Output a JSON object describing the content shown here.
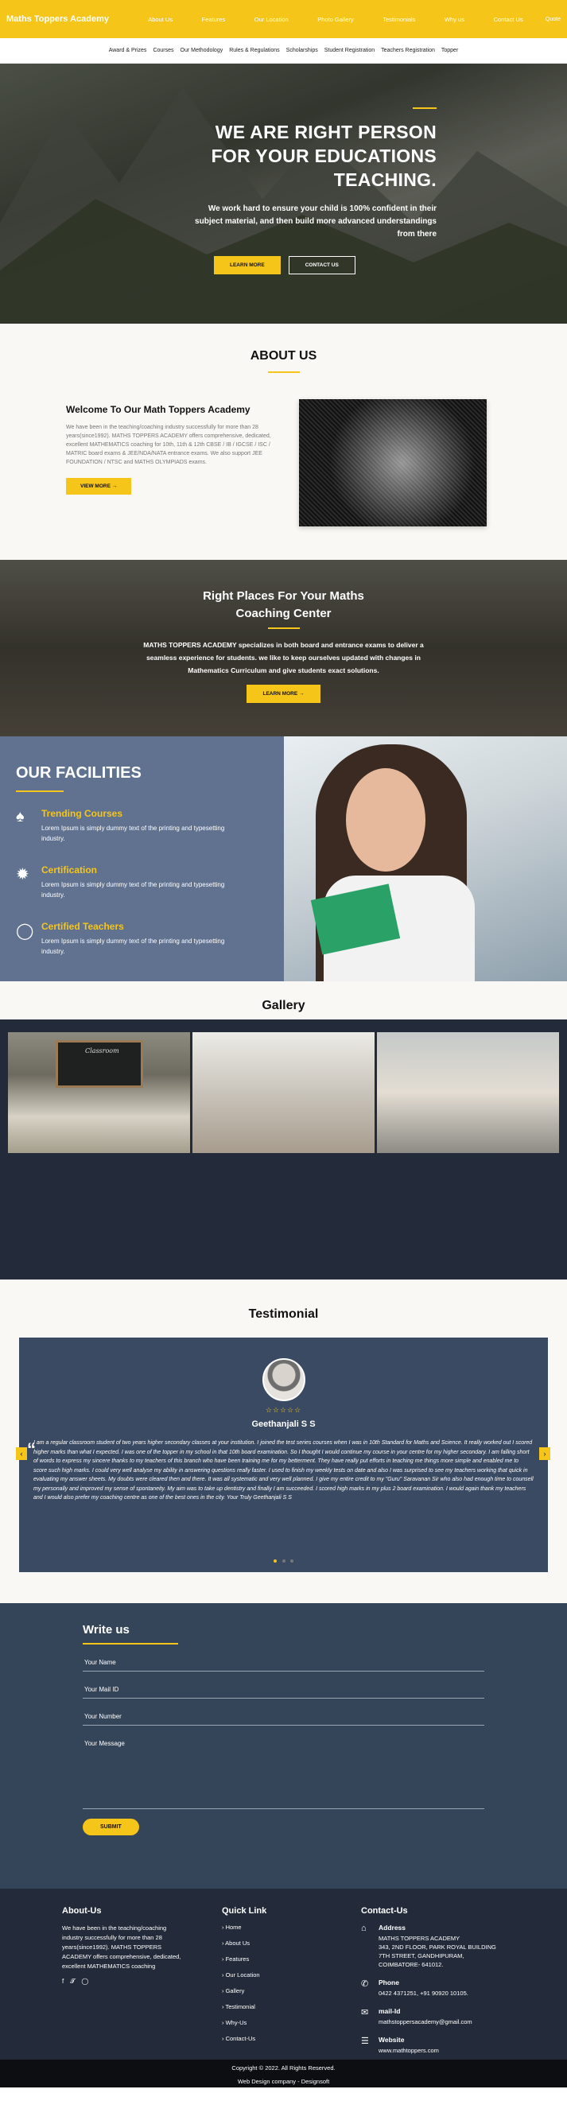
{
  "header": {
    "brand": "Maths Toppers Academy",
    "nav": [
      "About Us",
      "Features",
      "Our Location",
      "Photo Gallery",
      "Testimonials",
      "Why us",
      "Contact Us"
    ],
    "quote": "Quote"
  },
  "subnav": [
    "Award & Prizes",
    "Courses",
    "Our Methodology",
    "Rules & Regulations",
    "Scholarships",
    "Student Registration",
    "Teachers Registration",
    "Topper"
  ],
  "hero": {
    "title_l1": "WE ARE RIGHT PERSON",
    "title_l2": "FOR YOUR EDUCATIONS",
    "title_l3": "TEACHING.",
    "subtitle": "We work hard to ensure your child is 100% confident in their subject material, and then build more advanced understandings from there",
    "learn_more": "LEARN MORE",
    "contact_us": "CONTACT US"
  },
  "about": {
    "title": "ABOUT US",
    "heading": "Welcome To Our Math Toppers Academy",
    "text": "We have been in the teaching/coaching industry successfully for more than 28 years(since1992). MATHS TOPPERS ACADEMY offers comprehensive, dedicated, excellent MATHEMATICS coaching for 10th, 11th & 12th CBSE / IB / IGCSE / ISC / MATRIC board exams & JEE/NDA/NATA entrance exams. We also support JEE FOUNDATION / NTSC and MATHS OLYMPIADS exams.",
    "view_more": "VIEW MORE"
  },
  "coaching": {
    "title_l1": "Right Places For Your Maths",
    "title_l2": "Coaching Center",
    "text": "MATHS TOPPERS ACADEMY specializes in both board and entrance exams to deliver a seamless experience for students. we like to keep ourselves updated with changes in Mathematics Curriculum and give students exact solutions.",
    "learn_more": "LEARN MORE"
  },
  "facilities": {
    "title": "OUR FACILITIES",
    "items": [
      {
        "title": "Trending Courses",
        "text": "Lorem Ipsum is simply dummy text of the printing and typesetting industry.",
        "icon": "teacher-icon"
      },
      {
        "title": "Certification",
        "text": "Lorem Ipsum is simply dummy text of the printing and typesetting industry.",
        "icon": "badge-icon"
      },
      {
        "title": "Certified Teachers",
        "text": "Lorem Ipsum is simply dummy text of the printing and typesetting industry.",
        "icon": "lightbulb-icon"
      }
    ]
  },
  "gallery": {
    "title": "Gallery",
    "board_text": "Classroom"
  },
  "testimonial": {
    "title": "Testimonial",
    "stars": "☆☆☆☆☆",
    "name": "Geethanjali S S",
    "text": "I am a regular classroom student of two years higher secondary classes at your institution. I joined the test series courses when I was in 10th Standard for Maths and Science. It really worked out I scored higher marks than what I expected. I was one of the topper in my school in that 10th board examination. So I thought I would continue my course in your centre for my higher secondary. I am falling short of words to express my sincere thanks to my teachers of this branch who have been training me for my betterment. They have really put efforts in teaching me things more simple and enabled me to score such high marks. I could very well analyse my ability in answering questions really faster. I used to finish my weekly tests on date and also I was surprised to see my teachers working that quick in evaluating my answer sheets. My doubts were cleared then and there. It was all systematic and very well planned. I give my entire credit to my \"Guru\" Saravanan Sir who also had enough time to counsell my personally and improved my sense of spontaneity. My aim was to take up dentistry and finally I am succeeded. I scored high marks in my plus 2 board examination. I would again thank my teachers and I would also prefer my coaching centre as one of the best ones in the city. Your Truly Geethanjali S S"
  },
  "contact_form": {
    "title": "Write us",
    "name_placeholder": "Your Name",
    "mail_placeholder": "Your Mail ID",
    "number_placeholder": "Your Number",
    "message_placeholder": "Your Message",
    "submit": "SUBMIT"
  },
  "footer": {
    "about_title": "About-Us",
    "about_text": "We have been in the teaching/coaching industry successfully for more than 28 years(since1992). MATHS TOPPERS ACADEMY offers comprehensive, dedicated, excellent MATHEMATICS coaching",
    "quick_title": "Quick Link",
    "quick_links": [
      "Home",
      "About Us",
      "Features",
      "Our Location",
      "Gallery",
      "Testimonial",
      "Why-Us",
      "Contact-Us"
    ],
    "contact_title": "Contact-Us",
    "address_label": "Address",
    "address_l1": "MATHS TOPPERS ACADEMY",
    "address_l2": "343, 2ND FLOOR, PARK ROYAL BUILDING",
    "address_l3": "7TH STREET, GANDHIPURAM,",
    "address_l4": "COIMBATORE- 641012.",
    "phone_label": "Phone",
    "phone": "0422 4371251, +91 90920 10105.",
    "mail_label": "mail-Id",
    "mail": "mathstoppersacademy@gmail.com",
    "website_label": "Website",
    "website": "www.mathtoppers.com",
    "copyright": "Copyright © 2022. All Rights Reserved.",
    "design": "Web Design company - Designsoft"
  },
  "colors": {
    "accent": "#f6c519",
    "navy": "#354559",
    "dark": "#232b3a"
  }
}
